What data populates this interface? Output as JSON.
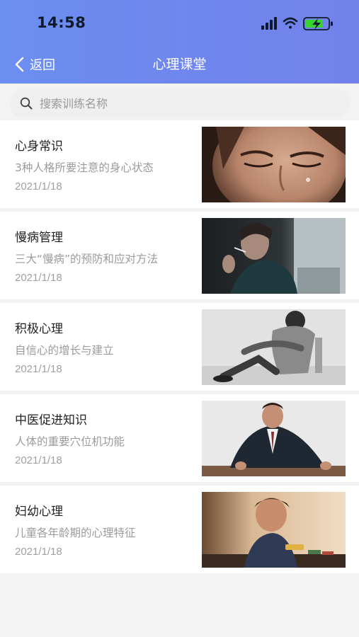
{
  "status_bar": {
    "time": "14:58"
  },
  "nav": {
    "back_label": "返回",
    "title": "心理课堂"
  },
  "search": {
    "placeholder": "搜索训练名称",
    "value": ""
  },
  "items": [
    {
      "title": "心身常识",
      "subtitle": "3种人格所要注意的身心状态",
      "date": "2021/1/18",
      "image": "crying-woman-photo"
    },
    {
      "title": "慢病管理",
      "subtitle": "三大“慢病”的预防和应对方法",
      "date": "2021/1/18",
      "image": "smoking-man-photo"
    },
    {
      "title": "积极心理",
      "subtitle": "自信心的增长与建立",
      "date": "2021/1/18",
      "image": "sitting-man-photo"
    },
    {
      "title": "中医促进知识",
      "subtitle": "人体的重要穴位机功能",
      "date": "2021/1/18",
      "image": "angry-businessman-photo"
    },
    {
      "title": "妇幼心理",
      "subtitle": "儿童各年龄期的心理特征",
      "date": "2021/1/18",
      "image": "child-playing-photo"
    }
  ]
}
